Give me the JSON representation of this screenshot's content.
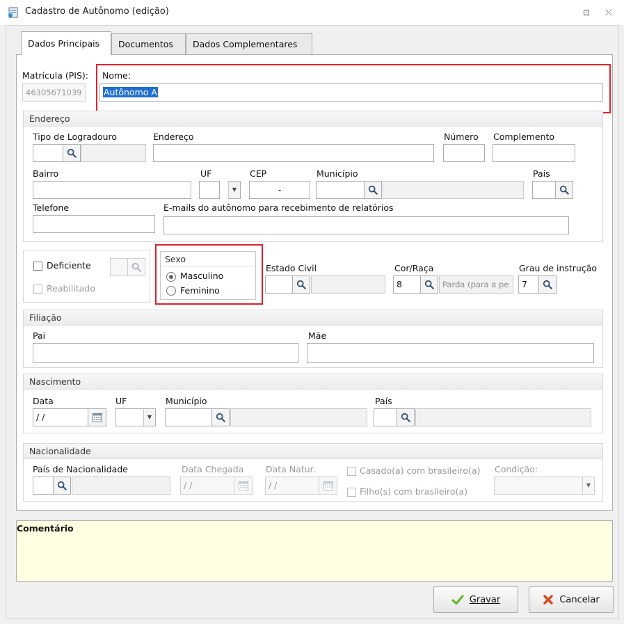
{
  "window": {
    "title": "Cadastro de Autônomo (edição)",
    "restore_icon": "⊡",
    "close_icon": "⤫"
  },
  "tabs": [
    {
      "label": "Dados Principais",
      "active": true
    },
    {
      "label": "Documentos",
      "active": false
    },
    {
      "label": "Dados Complementares",
      "active": false
    }
  ],
  "main": {
    "matricula_label": "Matrícula (PIS):",
    "matricula_value": "46305671039",
    "nome_label": "Nome:",
    "nome_value": "Autônomo A"
  },
  "endereco": {
    "group_title": "Endereço",
    "tipo_logradouro_label": "Tipo de Logradouro",
    "endereco_label": "Endereço",
    "numero_label": "Número",
    "complemento_label": "Complemento",
    "bairro_label": "Bairro",
    "uf_label": "UF",
    "cep_label": "CEP",
    "cep_value": "-",
    "municipio_label": "Município",
    "pais_label": "País",
    "telefone_label": "Telefone",
    "emails_label": "E-mails do autônomo para recebimento de relatórios"
  },
  "deficiencia": {
    "deficiente_label": "Deficiente",
    "reabilitado_label": "Reabilitado"
  },
  "sexo": {
    "group_title": "Sexo",
    "masculino_label": "Masculino",
    "feminino_label": "Feminino",
    "selected": "Masculino"
  },
  "pessoal": {
    "estado_civil_label": "Estado Civil",
    "cor_raca_label": "Cor/Raça",
    "cor_raca_code": "8",
    "cor_raca_desc": "Parda (para a pe",
    "grau_label": "Grau de instrução",
    "grau_code": "7"
  },
  "filiacao": {
    "group_title": "Filiação",
    "pai_label": "Pai",
    "mae_label": "Mãe"
  },
  "nascimento": {
    "group_title": "Nascimento",
    "data_label": "Data",
    "data_value": "/ /",
    "uf_label": "UF",
    "municipio_label": "Município",
    "pais_label": "País"
  },
  "nacionalidade": {
    "group_title": "Nacionalidade",
    "pais_nac_label": "País de Nacionalidade",
    "data_chegada_label": "Data Chegada",
    "data_chegada_value": "/ /",
    "data_natur_label": "Data Natur.",
    "data_natur_value": "/ /",
    "casado_label": "Casado(a) com brasileiro(a)",
    "filhos_label": "Filho(s) com brasileiro(a)",
    "condicao_label": "Condição:"
  },
  "comentario": {
    "title": "Comentário"
  },
  "buttons": {
    "gravar_label": "Gravar",
    "cancelar_label": "Cancelar"
  },
  "colors": {
    "highlight_red": "#d9232e",
    "selection_blue": "#1e6fd1",
    "comment_bg": "#ffffe1",
    "gravar_check": "#6bb52a",
    "cancelar_x": "#d9481e"
  }
}
